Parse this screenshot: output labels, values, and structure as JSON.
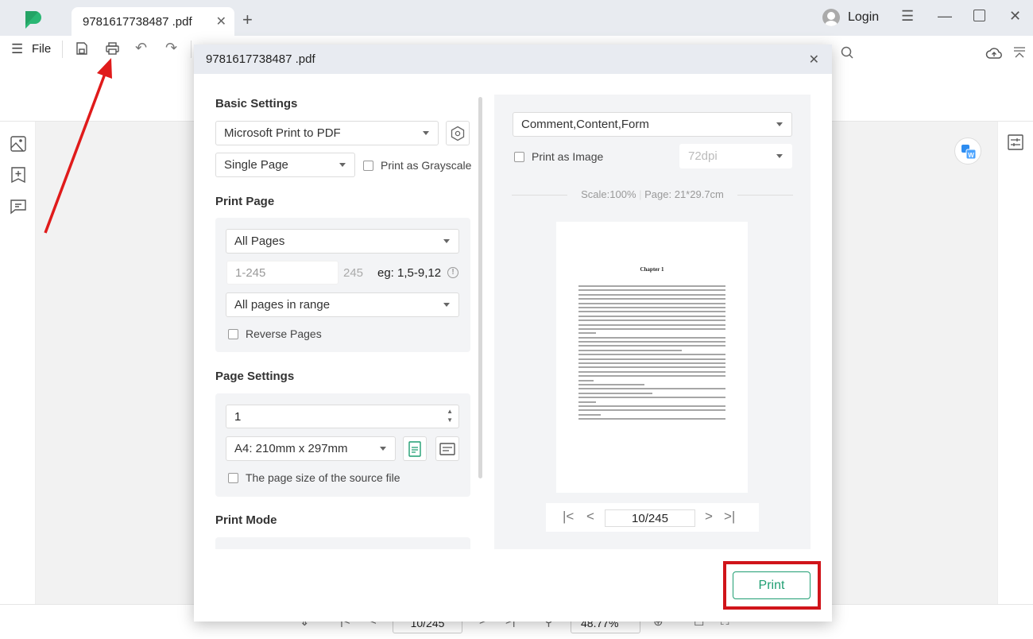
{
  "app": {
    "tab_title": "9781617738487 .pdf",
    "login_label": "Login"
  },
  "toolbar": {
    "file_label": "File"
  },
  "bottombar": {
    "page_indicator": "10/245",
    "zoom_level": "48.77%"
  },
  "dialog": {
    "title": "9781617738487 .pdf",
    "basic_settings": {
      "heading": "Basic Settings",
      "printer": "Microsoft Print to PDF",
      "layout": "Single Page",
      "grayscale_label": "Print as Grayscale",
      "grayscale_checked": false
    },
    "print_page": {
      "heading": "Print Page",
      "range_option": "All Pages",
      "range_placeholder": "1-245",
      "total_pages": "245",
      "range_hint": "eg: 1,5-9,12",
      "subset_option": "All pages in range",
      "reverse_label": "Reverse Pages",
      "reverse_checked": false
    },
    "page_settings": {
      "heading": "Page Settings",
      "copies": "1",
      "paper_size": "A4: 210mm x 297mm",
      "source_size_label": "The page size of the source file",
      "source_size_checked": false,
      "orientation": "portrait"
    },
    "print_mode": {
      "heading": "Print Mode"
    },
    "preview": {
      "content_option": "Comment,Content,Form",
      "print_as_image_label": "Print as Image",
      "print_as_image_checked": false,
      "dpi": "72dpi",
      "scale_text": "Scale:100%",
      "page_size_text": "Page: 21*29.7cm",
      "chapter_title": "Chapter 1",
      "current_page": "10/245"
    },
    "print_label": "Print"
  },
  "colors": {
    "accent": "#1f9e72",
    "highlight": "#d0141a",
    "annotation_arrow": "#e01b1b"
  }
}
